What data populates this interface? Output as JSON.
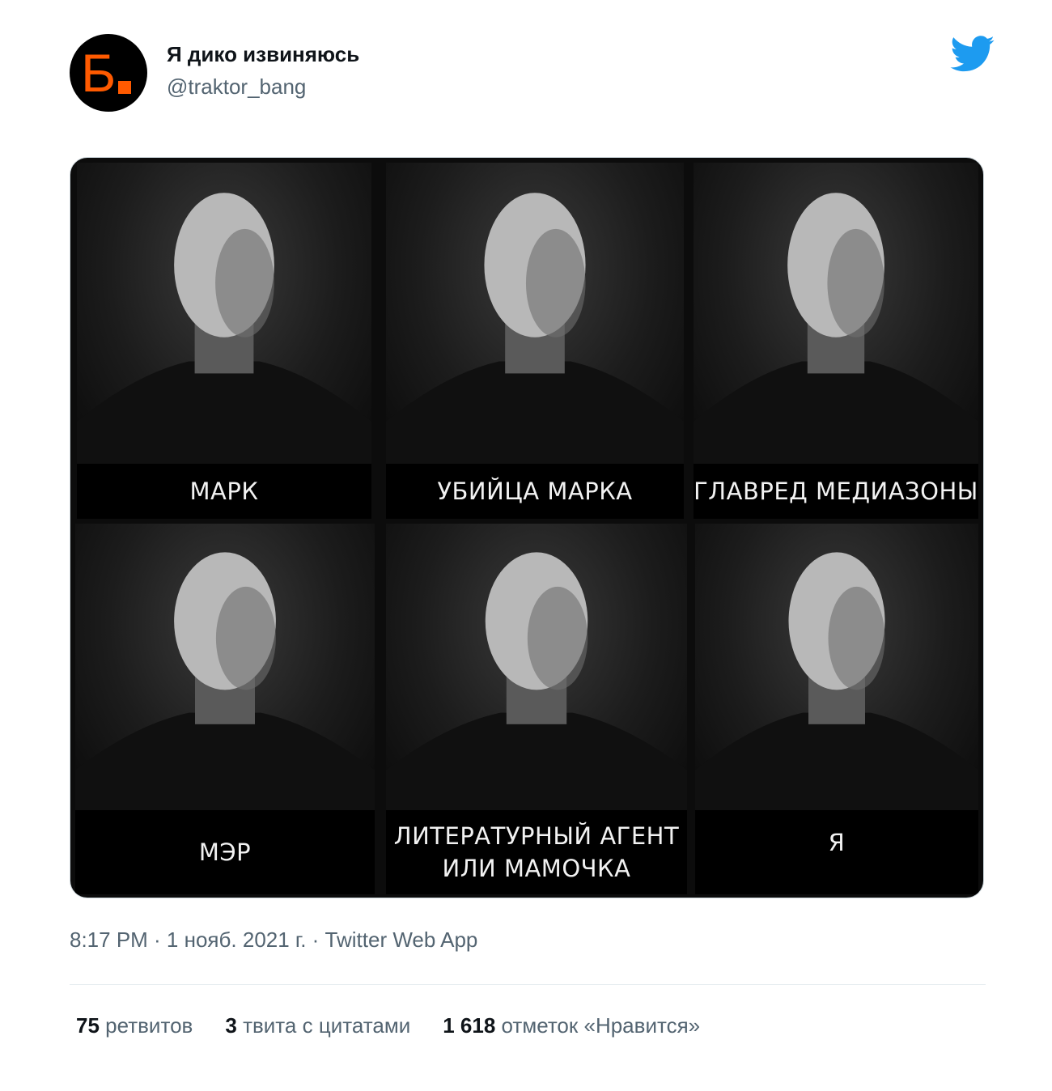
{
  "tweet": {
    "author": {
      "avatar_letter": "Б",
      "display_name": "Я дико извиняюсь",
      "handle": "@traktor_bang",
      "brand_color": "#ff5a00"
    },
    "twitter_icon": "twitter-bird-icon",
    "twitter_color": "#1d9bf0",
    "image_captions": [
      "МАРК",
      "УБИЙЦА МАРКА",
      "ГЛАВРЕД МЕДИАЗОНЫ",
      "МЭР",
      "ЛИТЕРАТУРНЫЙ АГЕНТ ИЛИ МАМОЧКА",
      "Я"
    ],
    "meta": "8:17 PM · 1 нояб. 2021 г. · Twitter Web App",
    "stats": {
      "retweets_count": "75",
      "retweets_label": "ретвитов",
      "quotes_count": "3",
      "quotes_label": "твита с цитатами",
      "likes_count": "1 618",
      "likes_label": "отметок «Нравится»"
    }
  }
}
